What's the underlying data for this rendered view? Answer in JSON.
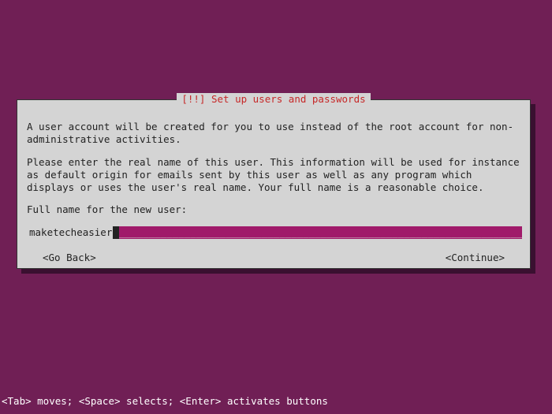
{
  "dialog": {
    "title": "[!!] Set up users and passwords",
    "paragraph1": "A user account will be created for you to use instead of the root account for non-administrative activities.",
    "paragraph2": "Please enter the real name of this user. This information will be used for instance as default origin for emails sent by this user as well as any program which displays or uses the user's real name. Your full name is a reasonable choice.",
    "prompt_label": "Full name for the new user:",
    "input_value": "maketecheasier",
    "go_back_label": "<Go Back>",
    "continue_label": "<Continue>"
  },
  "help_bar": "<Tab> moves; <Space> selects; <Enter> activates buttons"
}
